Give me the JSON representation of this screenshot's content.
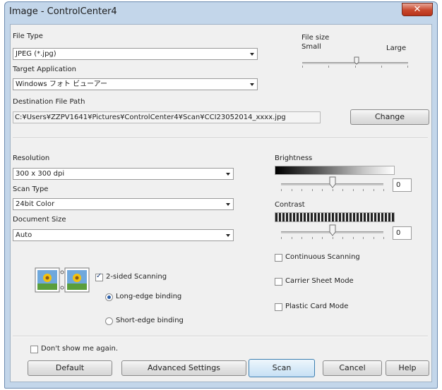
{
  "window": {
    "title": "Image - ControlCenter4",
    "close_icon": "close-icon"
  },
  "file_type": {
    "label": "File Type",
    "value": "JPEG (*.jpg)"
  },
  "file_size": {
    "label": "File size",
    "small": "Small",
    "large": "Large",
    "level": 0.55
  },
  "target_app": {
    "label": "Target Application",
    "value": "Windows フォト ビューアー"
  },
  "destination": {
    "label": "Destination File Path",
    "value": "C:¥Users¥ZZPV1641¥Pictures¥ControlCenter4¥Scan¥CCI23052014_xxxx.jpg",
    "change_label": "Change"
  },
  "resolution": {
    "label": "Resolution",
    "value": "300 x 300 dpi"
  },
  "scan_type": {
    "label": "Scan Type",
    "value": "24bit Color"
  },
  "document_size": {
    "label": "Document Size",
    "value": "Auto"
  },
  "brightness": {
    "label": "Brightness",
    "value": "0",
    "level": 0.5
  },
  "contrast": {
    "label": "Contrast",
    "value": "0",
    "level": 0.5
  },
  "options": {
    "continuous_scanning": {
      "label": "Continuous Scanning",
      "checked": false
    },
    "carrier_sheet_mode": {
      "label": "Carrier Sheet Mode",
      "checked": false
    },
    "plastic_card_mode": {
      "label": "Plastic Card Mode",
      "checked": false
    }
  },
  "duplex": {
    "label": "2-sided Scanning",
    "checked": true,
    "long_edge": {
      "label": "Long-edge binding",
      "selected": true
    },
    "short_edge": {
      "label": "Short-edge binding",
      "selected": false
    }
  },
  "dont_show": {
    "label": "Don't show me again.",
    "checked": false
  },
  "buttons": {
    "default": "Default",
    "advanced": "Advanced Settings",
    "scan": "Scan",
    "cancel": "Cancel",
    "help": "Help"
  }
}
